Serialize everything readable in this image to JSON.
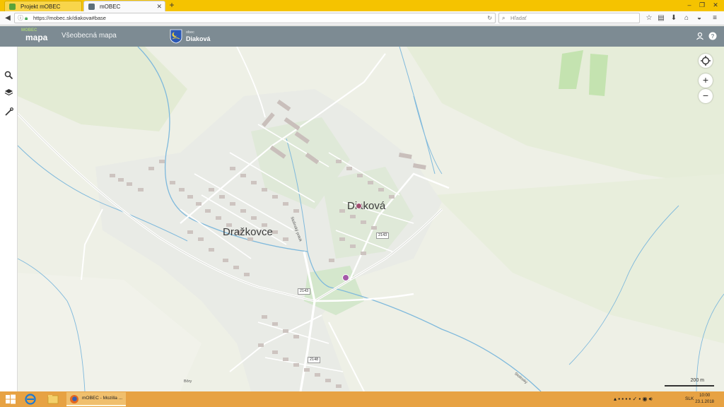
{
  "browser": {
    "tabs": [
      {
        "label": "Projekt mOBEC",
        "active": false
      },
      {
        "label": "mOBEC",
        "active": true
      }
    ],
    "url": "https://mobec.sk/diakova#base",
    "search_placeholder": "Hľadať"
  },
  "app": {
    "logo_top": "MOBEC",
    "logo_main": "mapa",
    "title": "Všeobecná mapa",
    "municipality_label": "obec",
    "municipality_name": "Diaková"
  },
  "map": {
    "places": {
      "town1": "Dražkovce",
      "town2": "Diaková"
    },
    "stream_label": "Stolinský potok",
    "stream_label_2": "Stolinský",
    "locality": "Bôry",
    "roads": [
      "2143",
      "2143",
      "2148"
    ],
    "scale": "200 m"
  },
  "taskbar": {
    "task_label": "mOBEC - Mozilla ...",
    "lang": "SLK",
    "time": "10:00",
    "date": "23.1.2018"
  },
  "colors": {
    "titlebar": "#f5c300",
    "header": "#7d8b93",
    "taskbar": "#e7a243",
    "map_bg": "#eef0e6",
    "water": "#7fb9dc"
  }
}
